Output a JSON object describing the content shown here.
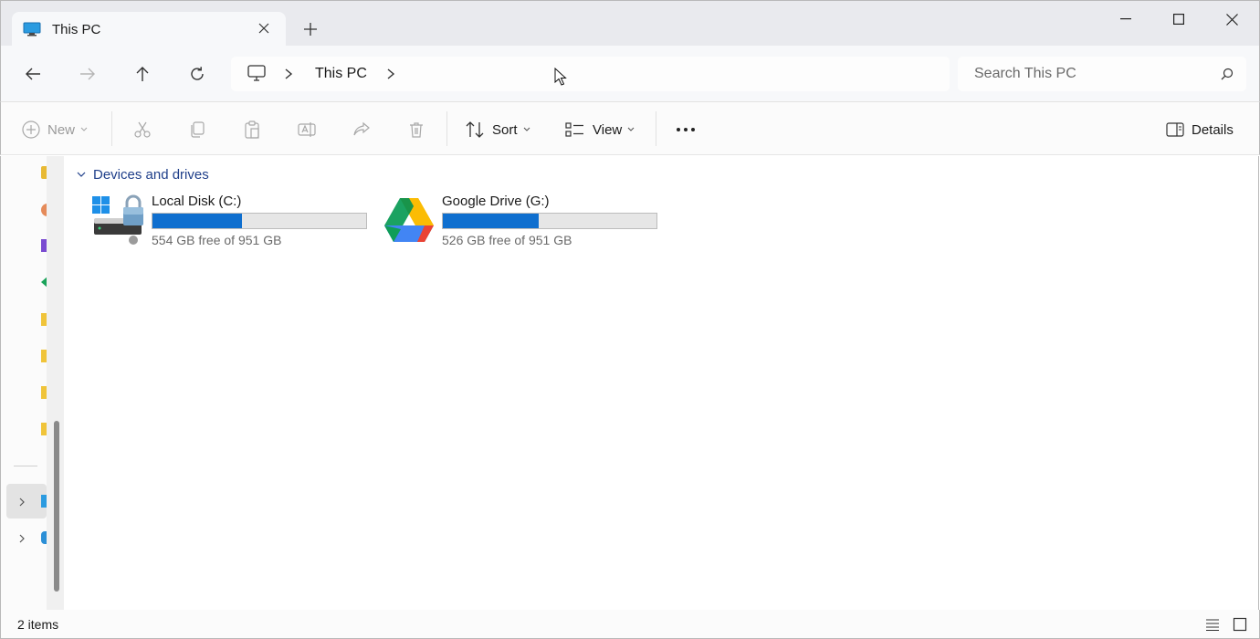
{
  "window": {
    "tab_title": "This PC",
    "minimize_icon": "minimize-icon",
    "maximize_icon": "maximize-icon",
    "close_icon": "close-icon"
  },
  "address_bar": {
    "crumbs": [
      "This PC"
    ],
    "search_placeholder": "Search This PC"
  },
  "command_bar": {
    "new_label": "New",
    "sort_label": "Sort",
    "view_label": "View",
    "details_label": "Details",
    "icons": [
      "cut-icon",
      "copy-icon",
      "paste-icon",
      "rename-icon",
      "share-icon",
      "delete-icon",
      "more-icon"
    ]
  },
  "content": {
    "group_title": "Devices and drives",
    "drives": [
      {
        "name": "Local Disk (C:)",
        "free_text": "554 GB free of 951 GB",
        "used_fraction": 0.4175,
        "icon": "windows-drive-icon"
      },
      {
        "name": "Google Drive (G:)",
        "free_text": "526 GB free of 951 GB",
        "used_fraction": 0.4469,
        "icon": "google-drive-icon"
      }
    ]
  },
  "status": {
    "item_count": "2 items"
  },
  "colors": {
    "accent": "#0f6fcf",
    "group_title": "#1f3f8a"
  }
}
